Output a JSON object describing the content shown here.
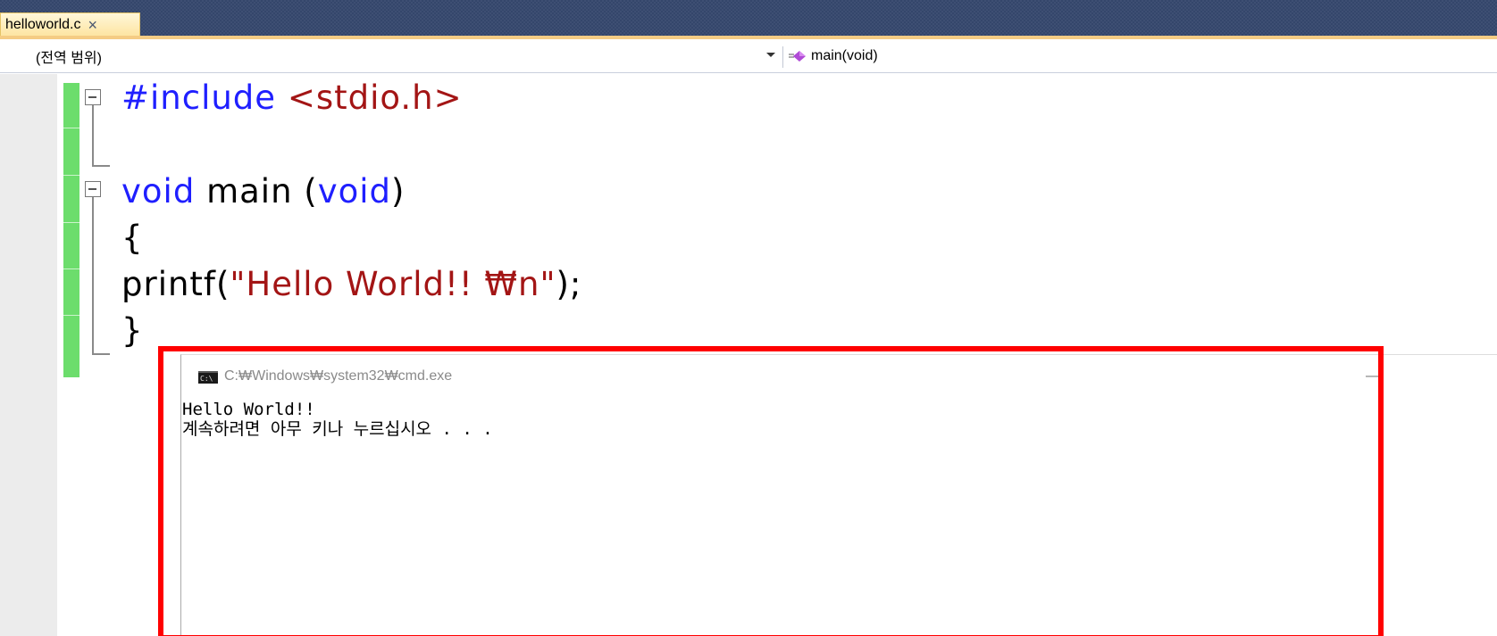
{
  "tab": {
    "label": "helloworld.c",
    "close": "×"
  },
  "nav": {
    "scope": "(전역 범위)",
    "member": "main(void)"
  },
  "code": {
    "line1": {
      "keyword": "#include",
      "rest": " <stdio.h>"
    },
    "line3": {
      "kw1": "void",
      "mid": " main (",
      "kw2": "void",
      "end": ")"
    },
    "line4": "{",
    "line5": {
      "fn": "printf(",
      "str": "\"Hello World!! ₩n\"",
      "end": ");"
    },
    "line6": "}"
  },
  "console": {
    "title": "C:₩Windows₩system32₩cmd.exe",
    "icon_text": "C:\\",
    "minimize": "—",
    "output": [
      "Hello World!!",
      "계속하려면 아무 키나 누르십시오 . . ."
    ]
  },
  "colors": {
    "tab_strip": "#34466b",
    "tab_active": "#fde4a0",
    "change_bar": "#6cdd6c",
    "keyword": "#1f1fff",
    "string": "#a31515",
    "highlight": "#ff0000"
  },
  "icons": {
    "tab_close": "close-icon",
    "dropdown": "chevron-down-icon",
    "member": "method-icon",
    "fold": "collapse-icon",
    "console": "cmd-icon"
  }
}
